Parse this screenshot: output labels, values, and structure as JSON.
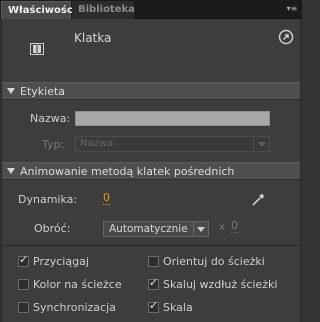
{
  "tabs": [
    {
      "label": "Właściwości",
      "active": true
    },
    {
      "label": "Biblioteka",
      "active": false
    }
  ],
  "symbol": {
    "title": "Klatka"
  },
  "sections": {
    "label": {
      "title": "Etykieta"
    },
    "tween": {
      "title": "Animowanie metodą klatek pośrednich"
    }
  },
  "label_section": {
    "name_label": "Nazwa:",
    "name_value": "",
    "type_label": "Typ:",
    "type_value": "Nazwa"
  },
  "tween_section": {
    "dynamics_label": "Dynamika:",
    "dynamics_value": "0",
    "rotate_label": "Obróć:",
    "rotate_value": "Automatycznie",
    "times": "x",
    "rotate_count": "0"
  },
  "checkboxes": {
    "snap": {
      "label": "Przyciągaj",
      "checked": true
    },
    "orient": {
      "label": "Orientuj do ścieżki",
      "checked": false
    },
    "color_path": {
      "label": "Kolor na ścieżce",
      "checked": false
    },
    "scale_path": {
      "label": "Skaluj wzdłuż ścieżki",
      "checked": true
    },
    "sync": {
      "label": "Synchronizacja",
      "checked": false
    },
    "scale": {
      "label": "Skala",
      "checked": true
    }
  },
  "icons": {
    "symbol": "movie-clip-icon",
    "edit": "edit-in-place-icon",
    "dropper": "eyedropper-icon",
    "panel_menu": "panel-menu-icon"
  },
  "colors": {
    "accent": "#e39a2a",
    "panel_bg": "#3d3d3d",
    "section_bg": "#4f4f4f",
    "tab_bar_bg": "#1b1b1b"
  }
}
